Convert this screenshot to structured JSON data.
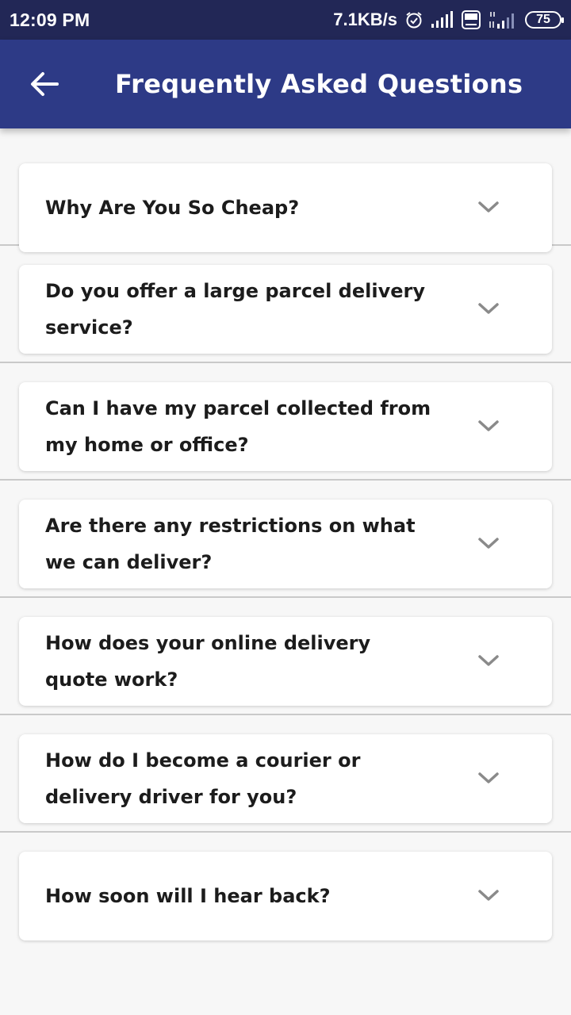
{
  "status_bar": {
    "time": "12:09 PM",
    "net_speed": "7.1KB/s",
    "volte_label": "Vo LTE",
    "network_type": "4G",
    "battery_level": "75",
    "icons": [
      "alarm-icon",
      "signal-icon",
      "volte-icon",
      "signal-4g-icon",
      "battery-icon"
    ]
  },
  "header": {
    "title": "Frequently Asked Questions",
    "back_icon": "arrow-left-icon"
  },
  "faq": {
    "items": [
      {
        "question": "Why Are You So Cheap?"
      },
      {
        "question": "Do you offer a large parcel delivery service?"
      },
      {
        "question": "Can I have my parcel collected from my home or office?"
      },
      {
        "question": "Are there any restrictions on what we can deliver?"
      },
      {
        "question": "How does your online delivery quote work?"
      },
      {
        "question": "How do I become a courier or delivery driver for you?"
      },
      {
        "question": "How soon will I hear back?"
      }
    ],
    "expand_icon": "chevron-down-icon"
  },
  "colors": {
    "status_bar": "#222756",
    "app_bar": "#2d3a86",
    "background": "#f7f7f7",
    "card": "#ffffff",
    "text": "#1c1c1c",
    "chevron": "#8a8a8a"
  }
}
